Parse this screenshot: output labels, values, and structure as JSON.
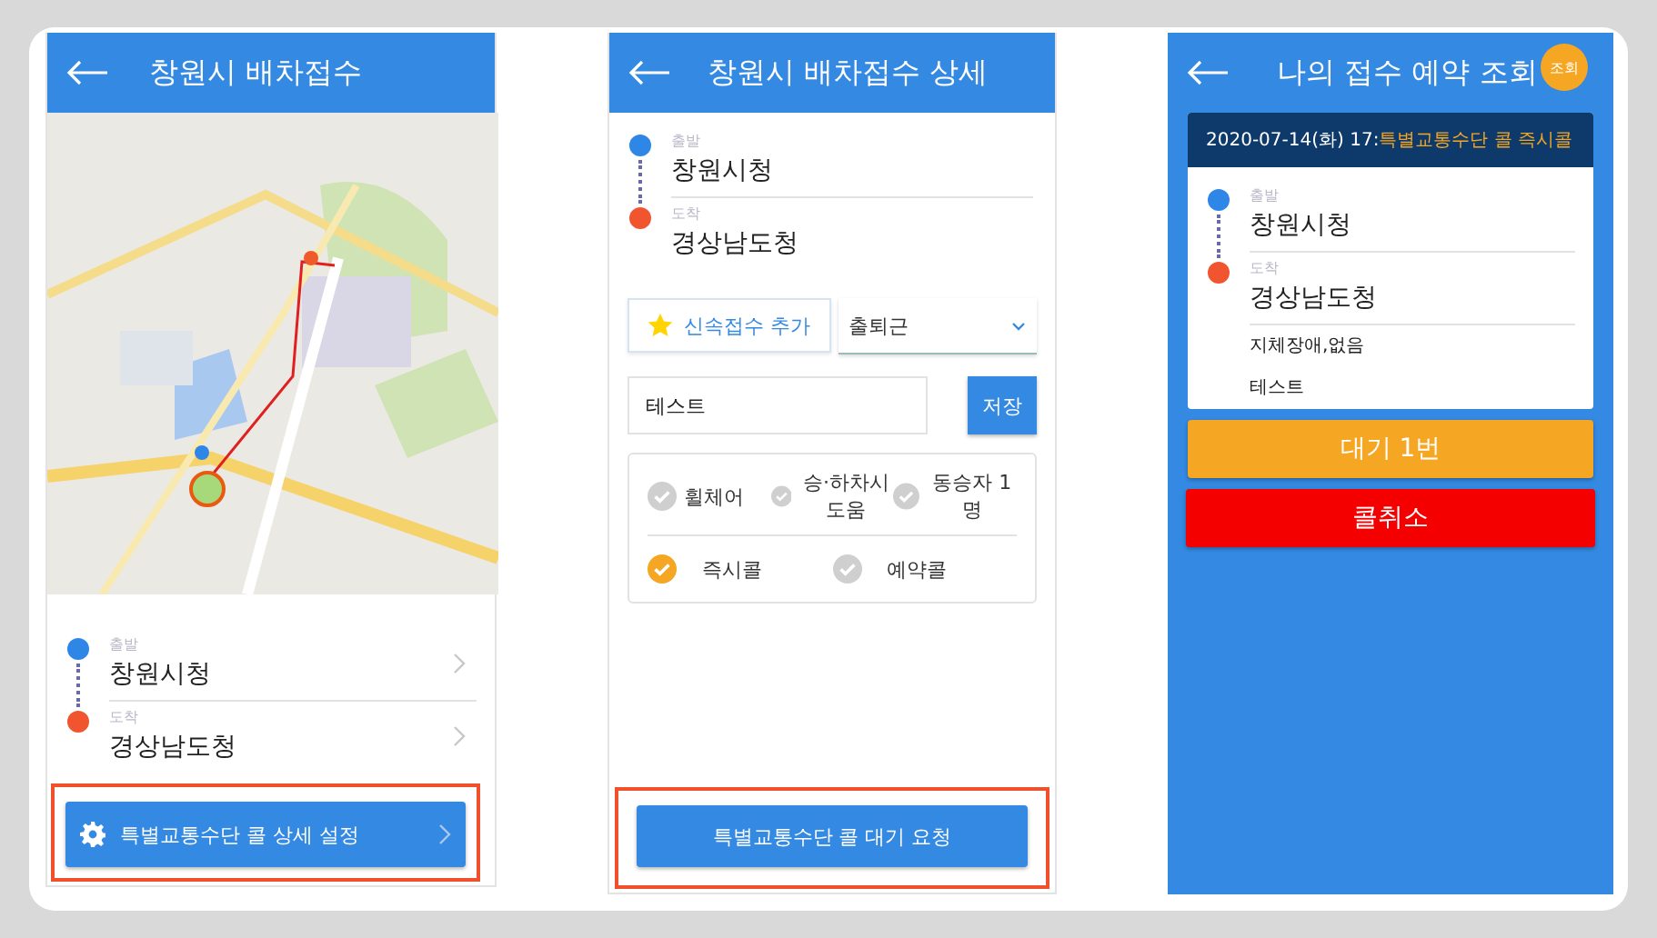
{
  "dispatch": {
    "title": "창원시 배차접수",
    "route": {
      "origin": {
        "label": "출발",
        "place": "창원시청"
      },
      "destination": {
        "label": "도착",
        "place": "경상남도청"
      }
    },
    "settings_button": "특별교통수단 콜 상세 설정"
  },
  "detail": {
    "title": "창원시 배차접수 상세",
    "route": {
      "origin": {
        "label": "출발",
        "place": "창원시청"
      },
      "destination": {
        "label": "도착",
        "place": "경상남도청"
      }
    },
    "favorite_button": "신속접수 추가",
    "purpose_select": {
      "value": "출퇴근"
    },
    "memo": {
      "value": "테스트"
    },
    "save_button": "저장",
    "options": [
      {
        "label": "휠체어",
        "checked": false
      },
      {
        "label": "승·하차시 도움",
        "checked": false
      },
      {
        "label": "동승자 1명",
        "checked": false
      }
    ],
    "call_types": [
      {
        "label": "즉시콜",
        "selected": true
      },
      {
        "label": "예약콜",
        "selected": false
      }
    ],
    "request_button": "특별교통수단 콜 대기 요청"
  },
  "my_reservation": {
    "title": "나의 접수 예약 조회",
    "lookup_badge": "조회",
    "card": {
      "datetime": "2020-07-14(화) 17:",
      "call_type": "특별교통수단 콜 즉시콜",
      "route": {
        "origin": {
          "label": "출발",
          "place": "창원시청"
        },
        "destination": {
          "label": "도착",
          "place": "경상남도청"
        }
      },
      "notes": [
        "지체장애,없음",
        "테스트"
      ]
    },
    "waiting_button": "대기 1번",
    "cancel_button": "콜취소"
  }
}
